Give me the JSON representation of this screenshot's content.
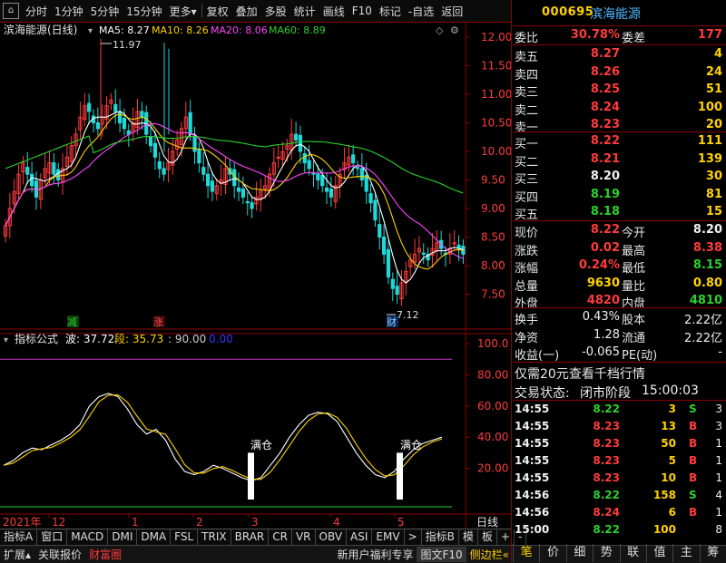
{
  "toolbar": {
    "items": [
      "分时",
      "1分钟",
      "5分钟",
      "15分钟",
      "更多",
      "复权",
      "叠加",
      "多股",
      "统计",
      "画线",
      "F10",
      "标记",
      "-自选",
      "返回"
    ],
    "home_icon": "home-icon"
  },
  "chart": {
    "title": "滨海能源(日线)",
    "ma": [
      {
        "label": "MA5: 8.27",
        "color": "#ffffff"
      },
      {
        "label": "MA10: 8.26",
        "color": "#ffd200"
      },
      {
        "label": "MA20: 8.06",
        "color": "#ff44ff"
      },
      {
        "label": "MA60: 8.89",
        "color": "#2bd12b"
      }
    ],
    "high_label": "11.97",
    "low_label": "7.12",
    "price_axis": [
      "12.00",
      "11.50",
      "11.00",
      "10.50",
      "10.00",
      "9.50",
      "9.00",
      "8.50",
      "8.00",
      "7.50"
    ],
    "markers": {
      "jian": "减",
      "zhang": "涨",
      "cai": "财"
    }
  },
  "indicator": {
    "title": "指标公式",
    "wave_label": "波: 37.72",
    "seg_label": "段: 35.73",
    "value3": ": 90.00",
    "value4": "0.00",
    "axis": [
      "100.0",
      "80.00",
      "60.00",
      "40.00",
      "20.00"
    ],
    "cang1": "满仓",
    "cang2": "满仓"
  },
  "date_axis": {
    "year": "2021年",
    "months": [
      "12",
      "1",
      "2",
      "3",
      "4",
      "5"
    ],
    "period": "日线"
  },
  "stock": {
    "code": "000695",
    "name": "滨海能源"
  },
  "orderbook": {
    "weibi": {
      "label": "委比",
      "value": "30.78%"
    },
    "weicha": {
      "label": "委差",
      "value": "177"
    },
    "sell": [
      {
        "label": "卖五",
        "price": "8.27",
        "vol": "4"
      },
      {
        "label": "卖四",
        "price": "8.26",
        "vol": "24"
      },
      {
        "label": "卖三",
        "price": "8.25",
        "vol": "51"
      },
      {
        "label": "卖二",
        "price": "8.24",
        "vol": "100"
      },
      {
        "label": "卖一",
        "price": "8.23",
        "vol": "20"
      }
    ],
    "buy": [
      {
        "label": "买一",
        "price": "8.22",
        "vol": "111"
      },
      {
        "label": "买二",
        "price": "8.21",
        "vol": "139"
      },
      {
        "label": "买三",
        "price": "8.20",
        "vol": "30"
      },
      {
        "label": "买四",
        "price": "8.19",
        "vol": "81"
      },
      {
        "label": "买五",
        "price": "8.18",
        "vol": "15"
      }
    ]
  },
  "quote": {
    "xianjia": {
      "label": "现价",
      "value": "8.22"
    },
    "jinkai": {
      "label": "今开",
      "value": "8.20"
    },
    "zhangdie": {
      "label": "涨跌",
      "value": "0.02"
    },
    "zuigao": {
      "label": "最高",
      "value": "8.38"
    },
    "zhangfu": {
      "label": "涨幅",
      "value": "0.24%"
    },
    "zuidi": {
      "label": "最低",
      "value": "8.15"
    },
    "zongliang": {
      "label": "总量",
      "value": "9630"
    },
    "liangbi": {
      "label": "量比",
      "value": "0.80"
    },
    "waipan": {
      "label": "外盘",
      "value": "4820"
    },
    "neipan": {
      "label": "内盘",
      "value": "4810"
    },
    "huanshou": {
      "label": "换手",
      "value": "0.43%"
    },
    "guben": {
      "label": "股本",
      "value": "2.22亿"
    },
    "jingzi": {
      "label": "净资",
      "value": "1.28"
    },
    "liutong": {
      "label": "流通",
      "value": "2.22亿"
    },
    "shouyi": {
      "label": "收益(一)",
      "value": "-0.065"
    },
    "pe": {
      "label": "PE(动)",
      "value": "-"
    }
  },
  "promo": "仅需20元查看千档行情",
  "status": {
    "label": "交易状态:",
    "value": "闭市阶段",
    "time": "15:00:03"
  },
  "ticks": [
    {
      "time": "14:55",
      "price": "8.22",
      "vol": "3",
      "side": "S",
      "n": "3"
    },
    {
      "time": "14:55",
      "price": "8.23",
      "vol": "13",
      "side": "B",
      "n": "3"
    },
    {
      "time": "14:55",
      "price": "8.23",
      "vol": "50",
      "side": "B",
      "n": "1"
    },
    {
      "time": "14:55",
      "price": "8.23",
      "vol": "5",
      "side": "B",
      "n": "1"
    },
    {
      "time": "14:55",
      "price": "8.23",
      "vol": "10",
      "side": "B",
      "n": "1"
    },
    {
      "time": "14:56",
      "price": "8.22",
      "vol": "158",
      "side": "S",
      "n": "4"
    },
    {
      "time": "14:56",
      "price": "8.24",
      "vol": "6",
      "side": "B",
      "n": "1"
    },
    {
      "time": "15:00",
      "price": "8.22",
      "vol": "100",
      "side": "",
      "n": "8"
    }
  ],
  "indicator_tabs": [
    "指标A",
    "窗口",
    "MACD",
    "DMI",
    "DMA",
    "FSL",
    "TRIX",
    "BRAR",
    "CR",
    "VR",
    "OBV",
    "ASI",
    "EMV",
    ">",
    "指标B",
    "模",
    "板",
    "+",
    "-"
  ],
  "bottom_bar": {
    "left": [
      "扩展",
      "关联报价",
      "财富圈"
    ],
    "right": [
      "新用户福利专享",
      "图文F10",
      "侧边栏"
    ]
  },
  "right_tabs": [
    "笔",
    "价",
    "细",
    "势",
    "联",
    "值",
    "主",
    "筹"
  ],
  "colors": {
    "up": "#ff3b3b",
    "down": "#1fd8d8",
    "ma60": "#2bd12b"
  }
}
